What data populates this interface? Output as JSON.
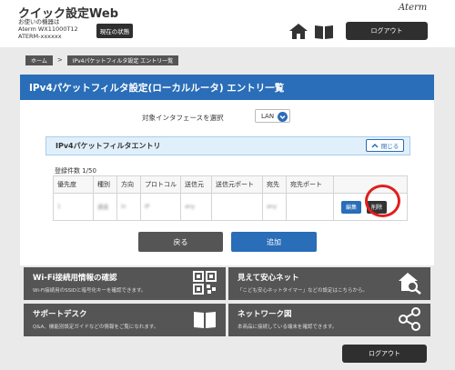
{
  "header": {
    "app_title": "クイック設定Web",
    "device_line1": "お使いの機器は",
    "device_line2": "Aterm WX11000T12",
    "device_line3": "ATERM-xxxxxx",
    "status_button": "現在の状態",
    "brand": "Aterm",
    "logout": "ログアウト",
    "icons": [
      "home-icon",
      "book-icon"
    ]
  },
  "breadcrumb": {
    "home": "ホーム",
    "separator": ">",
    "current": "IPv4パケットフィルタ設定 エントリ一覧"
  },
  "page": {
    "title": "IPv4パケットフィルタ設定(ローカルルータ) エントリ一覧",
    "interface_label": "対象インタフェースを選択",
    "interface_value": "LAN",
    "section_title": "IPv4パケットフィルタエントリ",
    "close_button": "閉じる",
    "count_text": "登録件数 1/50"
  },
  "table": {
    "columns": [
      "優先度",
      "種別",
      "方向",
      "プロトコル",
      "送信元",
      "送信元ポート",
      "宛先",
      "宛先ポート",
      ""
    ],
    "rows": [
      {
        "priority": "1",
        "type": "通過",
        "direction": "in",
        "protocol": "IP",
        "src": "any",
        "src_port": "",
        "dst": "any",
        "dst_port": "",
        "edit": "編集",
        "delete": "削除"
      }
    ]
  },
  "actions": {
    "back": "戻る",
    "add": "追加"
  },
  "tiles": [
    {
      "title": "Wi-Fi接続用情報の確認",
      "desc": "Wi-Fi接続用のSSIDと暗号化キーを確認できます。",
      "icon": "qr-code-icon"
    },
    {
      "title": "見えて安心ネット",
      "desc": "「こども安心ネットタイマー」などの設定はこちらから。",
      "icon": "house-search-icon"
    },
    {
      "title": "サポートデスク",
      "desc": "Q&A、機能別設定ガイドなどの情報をご覧になれます。",
      "icon": "book-open-icon"
    },
    {
      "title": "ネットワーク図",
      "desc": "本商品に接続している端末を確認できます。",
      "icon": "network-share-icon"
    }
  ],
  "footer": {
    "logout": "ログアウト"
  },
  "colors": {
    "accent": "#2a6db8",
    "dark_button": "#2f2f2f",
    "highlight": "#e01e1e",
    "tile": "#555555"
  }
}
